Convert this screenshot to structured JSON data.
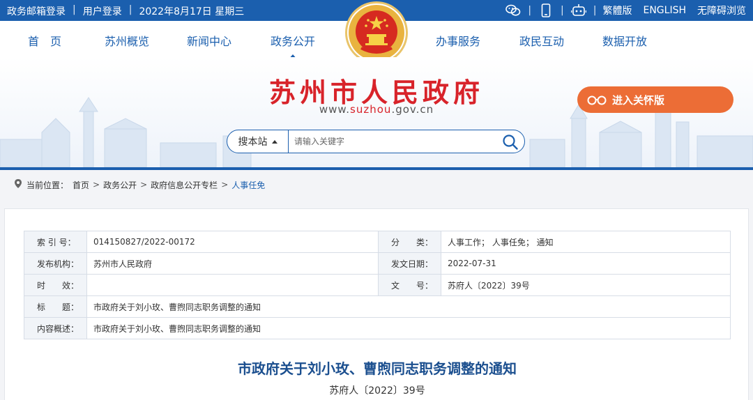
{
  "topbar": {
    "left_links": [
      "政务邮箱登录",
      "用户登录",
      "2022年8月17日 星期三"
    ],
    "separator": "|",
    "right_links": [
      "繁體版",
      "ENGLISH",
      "无障碍浏览"
    ]
  },
  "nav": {
    "items": [
      "首　页",
      "苏州概览",
      "新闻中心",
      "政务公开",
      "办事服务",
      "政民互动",
      "数据开放"
    ],
    "active": "政务公开"
  },
  "header": {
    "site_title": "苏州市人民政府",
    "url_prefix": "www.",
    "url_brand": "suzhou",
    "url_suffix": ".gov.cn",
    "care_label": "进入关怀版"
  },
  "search": {
    "scope_label": "搜本站",
    "placeholder": "请输入关键字"
  },
  "breadcrumb": {
    "prefix": "当前位置：",
    "items": [
      "首页",
      "政务公开",
      "政府信息公开专栏",
      "人事任免"
    ],
    "sep": ">"
  },
  "meta": {
    "rows": [
      {
        "l1": "索 引 号：",
        "v1": "014150827/2022-00172",
        "l2": "分　　类：",
        "v2": "人事工作； 人事任免； 通知"
      },
      {
        "l1": "发布机构：",
        "v1": "苏州市人民政府",
        "l2": "发文日期：",
        "v2": "2022-07-31"
      },
      {
        "l1": "时　　效：",
        "v1": "",
        "l2": "文　　号：",
        "v2": "苏府人〔2022〕39号"
      }
    ],
    "wide_rows": [
      {
        "l": "标　　题：",
        "v": "市政府关于刘小玫、曹煦同志职务调整的通知"
      },
      {
        "l": "内容概述：",
        "v": "市政府关于刘小玫、曹煦同志职务调整的通知"
      }
    ]
  },
  "article": {
    "title": "市政府关于刘小玫、曹煦同志职务调整的通知",
    "doc_no": "苏府人〔2022〕39号"
  },
  "colors": {
    "primary": "#1b5fae",
    "red": "#d8232a",
    "orange": "#ec6d36"
  }
}
